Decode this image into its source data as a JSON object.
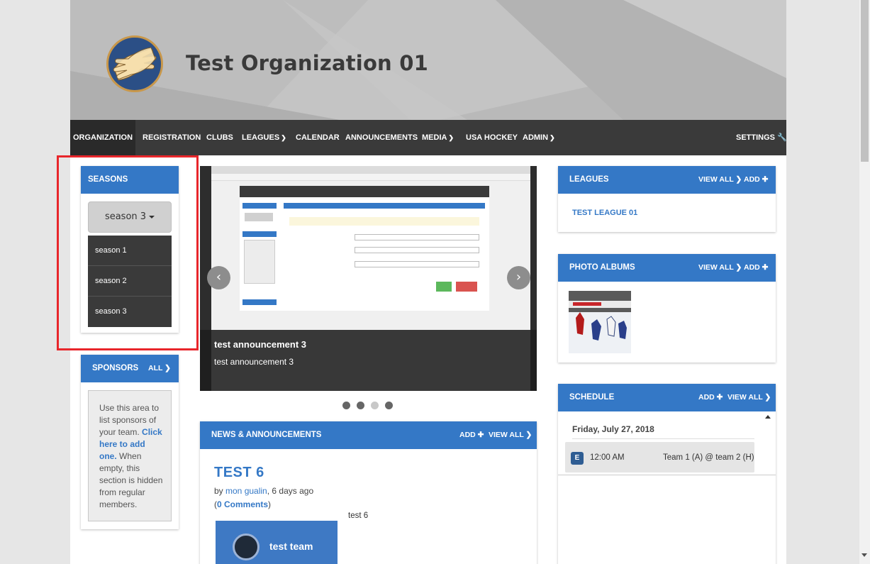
{
  "header": {
    "org_title": "Test Organization 01"
  },
  "nav": {
    "items": [
      {
        "label": "ORGANIZATION",
        "active": true
      },
      {
        "label": "REGISTRATION"
      },
      {
        "label": "CLUBS"
      },
      {
        "label": "LEAGUES",
        "dropdown": true
      },
      {
        "label": "CALENDAR"
      },
      {
        "label": "ANNOUNCEMENTS"
      },
      {
        "label": "MEDIA",
        "dropdown": true
      },
      {
        "label": "USA HOCKEY"
      },
      {
        "label": "ADMIN",
        "dropdown": true
      }
    ],
    "settings_label": "SETTINGS"
  },
  "seasons": {
    "title": "SEASONS",
    "selected": "season 3",
    "options": [
      "season 1",
      "season 2",
      "season 3"
    ]
  },
  "sponsors": {
    "title": "SPONSORS",
    "all_label": "ALL",
    "text_before": "Use this area to list sponsors of your team.",
    "link_text": "Click here to add one.",
    "text_after": "When empty, this section is hidden from regular members."
  },
  "carousel": {
    "caption_title": "test announcement 3",
    "caption_text": "test announcement 3",
    "slide_count": 4,
    "active_slide": 3
  },
  "news": {
    "title": "NEWS & ANNOUNCEMENTS",
    "add_label": "ADD",
    "view_all_label": "VIEW ALL",
    "post_title": "TEST 6",
    "by_prefix": "by ",
    "author": "mon gualin",
    "date_text": ", 6 days ago",
    "comments_label": "0 Comments",
    "body": "test 6",
    "thumb_team": "test team"
  },
  "leagues": {
    "title": "LEAGUES",
    "view_all_label": "VIEW ALL",
    "add_label": "ADD",
    "items": [
      "TEST LEAGUE 01"
    ]
  },
  "photo_albums": {
    "title": "PHOTO ALBUMS",
    "view_all_label": "VIEW ALL",
    "add_label": "ADD"
  },
  "schedule": {
    "title": "SCHEDULE",
    "add_label": "ADD",
    "view_all_label": "VIEW ALL",
    "date": "Friday, July 27, 2018",
    "events": [
      {
        "badge": "E",
        "time": "12:00 AM",
        "matchup": "Team 1 (A) @ team 2 (H)"
      }
    ]
  },
  "colors": {
    "primary": "#3478c6",
    "nav_bg": "#3a3a3a",
    "highlight": "#e8262b"
  }
}
